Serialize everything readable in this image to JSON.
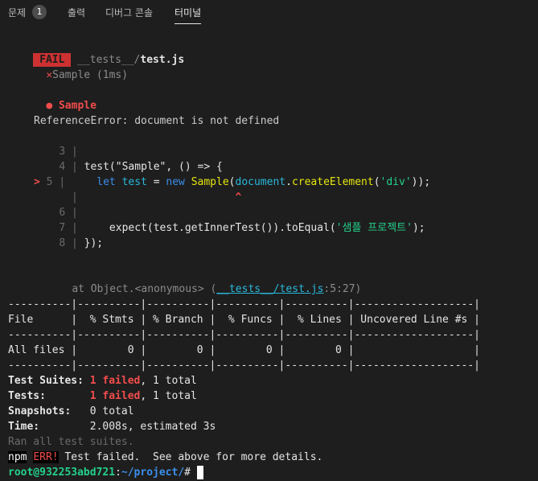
{
  "tabs": [
    {
      "label": "문제",
      "badge": "1"
    },
    {
      "label": "출력"
    },
    {
      "label": "디버그 콘솔"
    },
    {
      "label": "터미널"
    }
  ],
  "fail_header": {
    "badge": "FAIL",
    "path_dir": "__tests__/",
    "path_file": "test.js"
  },
  "failed_test": {
    "mark": "✕",
    "label": "Sample (1ms)"
  },
  "suite_title": {
    "bullet": "●",
    "label": "Sample"
  },
  "error_message": "ReferenceError: document is not defined",
  "code_frame": {
    "lines": [
      {
        "num": "3",
        "code": ""
      },
      {
        "num": "4",
        "code": "test(\"Sample\", () => {"
      },
      {
        "num": "5",
        "marker": ">",
        "pre": "    ",
        "let": "let",
        "var": "test",
        "eq": "=",
        "new": "new",
        "cls": "Sample",
        "p1": "(",
        "doc": "document",
        "dot": ".",
        "fn": "createElement",
        "p2": "(",
        "str": "'div'",
        "p3": "));"
      },
      {
        "caret": "^"
      },
      {
        "num": "6",
        "code": ""
      },
      {
        "num": "7",
        "code_pre": "    expect(test.getInnerTest()).toEqual(",
        "str": "'샘플 프로젝트'",
        "code_post": ");"
      },
      {
        "num": "8",
        "code": "});"
      }
    ],
    "bar": "|"
  },
  "stack": {
    "prefix": "at Object.<anonymous> (",
    "dir": "__tests__/",
    "file": "test.js",
    "loc": ":5:27)"
  },
  "coverage_table": {
    "rule_top": "----------|----------|----------|----------|----------|-------------------|",
    "header": "File      |  % Stmts | % Branch |  % Funcs |  % Lines | Uncovered Line #s |",
    "rule_mid": "----------|----------|----------|----------|----------|-------------------|",
    "row": "All files |        0 |        0 |        0 |        0 |                   |",
    "rule_bot": "----------|----------|----------|----------|----------|-------------------|"
  },
  "summary": {
    "suites_label": "Test Suites: ",
    "suites_failed": "1 failed",
    "suites_total": ", 1 total",
    "tests_label": "Tests:       ",
    "tests_failed": "1 failed",
    "tests_total": ", 1 total",
    "snapshots_label": "Snapshots:   ",
    "snapshots_value": "0 total",
    "time_label": "Time:        ",
    "time_value": "2.008s, estimated 3s",
    "ran_all": "Ran all test suites."
  },
  "npm_error": {
    "npm": "npm",
    "err": "ERR!",
    "message": " Test failed.  See above for more details."
  },
  "prompt": {
    "user_host": "root@932253abd721",
    "colon": ":",
    "path": "~/project/",
    "symbol": "# "
  },
  "colors": {
    "background": "#1e1e1e",
    "fail_red": "#cd3131",
    "error_red": "#f14c4c",
    "string_green": "#23d18b",
    "keyword_blue": "#3b8eea",
    "path_cyan": "#29b8db"
  }
}
